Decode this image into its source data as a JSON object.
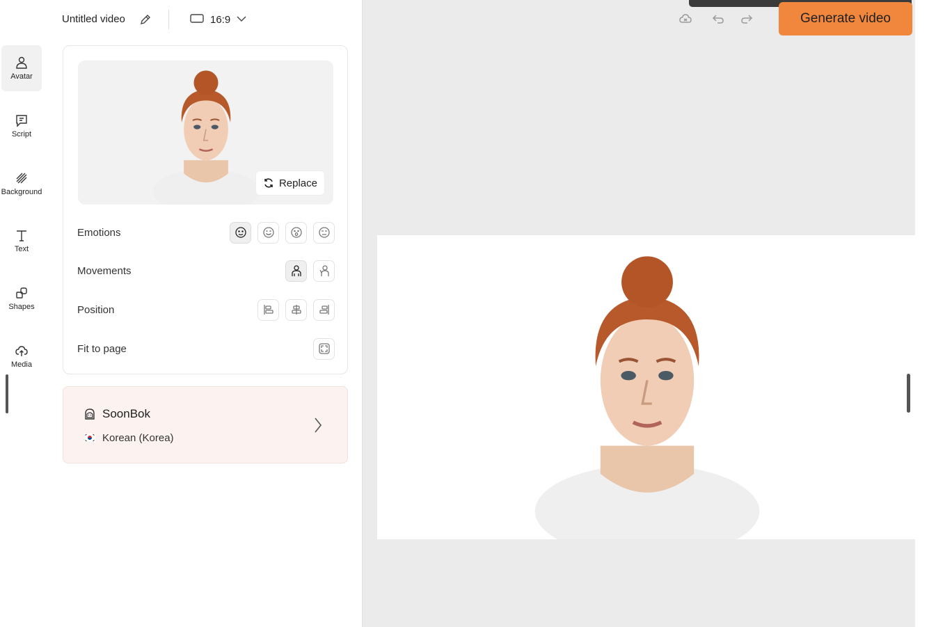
{
  "header": {
    "title": "Untitled video",
    "aspect_ratio": "16:9"
  },
  "sidebar": {
    "items": [
      {
        "label": "Avatar",
        "icon": "person-icon",
        "active": true
      },
      {
        "label": "Script",
        "icon": "chat-icon"
      },
      {
        "label": "Background",
        "icon": "hatch-icon"
      },
      {
        "label": "Text",
        "icon": "text-icon"
      },
      {
        "label": "Shapes",
        "icon": "shapes-icon"
      },
      {
        "label": "Media",
        "icon": "cloud-upload-icon"
      }
    ]
  },
  "avatar_panel": {
    "replace_label": "Replace",
    "emotions_label": "Emotions",
    "movements_label": "Movements",
    "position_label": "Position",
    "fit_label": "Fit to page"
  },
  "voice": {
    "name": "SoonBok",
    "language": "Korean (Korea)"
  },
  "toolbar": {
    "generate_label": "Generate video"
  },
  "colors": {
    "accent": "#f0873c",
    "voice_bg": "#fcf3f1",
    "canvas_bg": "#ebebeb"
  }
}
